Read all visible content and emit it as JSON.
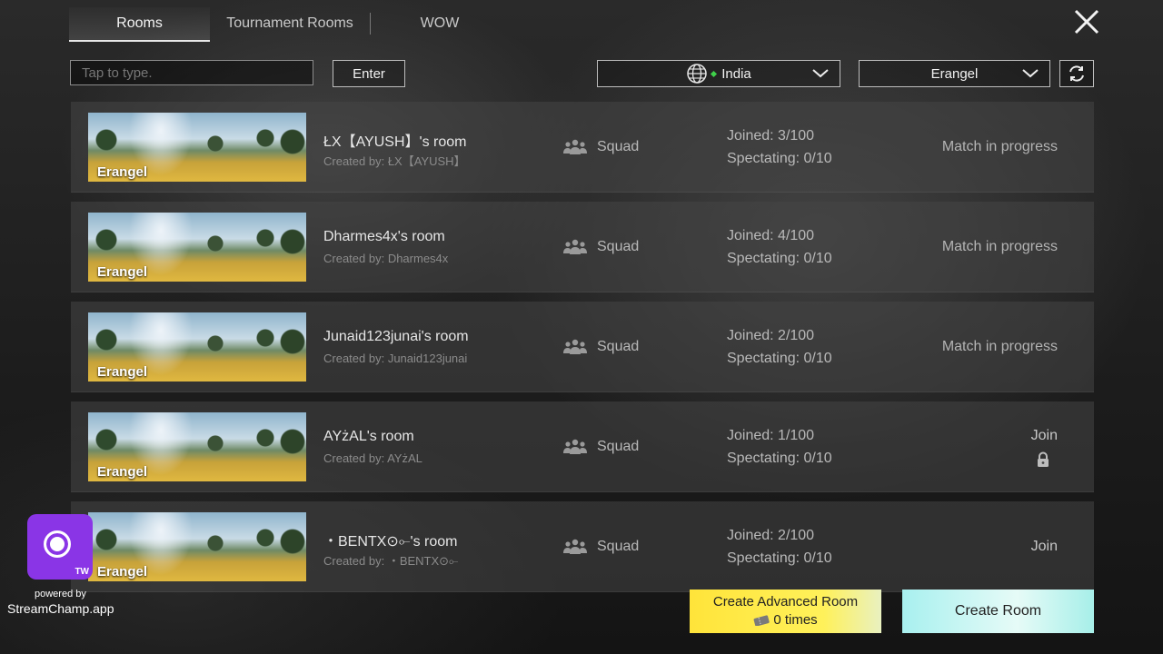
{
  "tabs": [
    {
      "label": "Rooms",
      "active": true
    },
    {
      "label": "Tournament Rooms",
      "active": false
    },
    {
      "label": "WOW",
      "active": false
    }
  ],
  "search": {
    "placeholder": "Tap to type."
  },
  "enter_label": "Enter",
  "region_label": "India",
  "map_label": "Erangel",
  "rooms": [
    {
      "map": "Erangel",
      "title": "ŁX【AYUSH】's room",
      "creator": "Created by: ŁX【AYUSH】",
      "mode": "Squad",
      "joined": "Joined: 3/100",
      "spectating": "Spectating: 0/10",
      "status": "Match in progress"
    },
    {
      "map": "Erangel",
      "title": "Dharmes4x's room",
      "creator": "Created by: Dharmes4x",
      "mode": "Squad",
      "joined": "Joined: 4/100",
      "spectating": "Spectating: 0/10",
      "status": "Match in progress"
    },
    {
      "map": "Erangel",
      "title": "Junaid123junai's room",
      "creator": "Created by: Junaid123junai",
      "mode": "Squad",
      "joined": "Joined: 2/100",
      "spectating": "Spectating: 0/10",
      "status": "Match in progress"
    },
    {
      "map": "Erangel",
      "title": "AYżAL's room",
      "creator": "Created by: AYżAL",
      "mode": "Squad",
      "joined": "Joined: 1/100",
      "spectating": "Spectating: 0/10",
      "status": "Join",
      "locked": true
    },
    {
      "map": "Erangel",
      "title": "・BENTX⊙⟜'s room",
      "creator": "Created by: ・BENTX⊙⟜",
      "mode": "Squad",
      "joined": "Joined: 2/100",
      "spectating": "Spectating: 0/10",
      "status": "Join"
    }
  ],
  "create_advanced": {
    "line1": "Create Advanced Room",
    "line2": "0 times"
  },
  "create_room_label": "Create Room",
  "stream": {
    "badge": "TW",
    "powered": "powered by",
    "brand": "StreamChamp.app"
  },
  "colors": {
    "accent_yellow": "#ffe43a",
    "accent_cyan": "#a8f0ef",
    "region_dot": "#3fd14a",
    "stream_purple": "#8a35e6"
  }
}
